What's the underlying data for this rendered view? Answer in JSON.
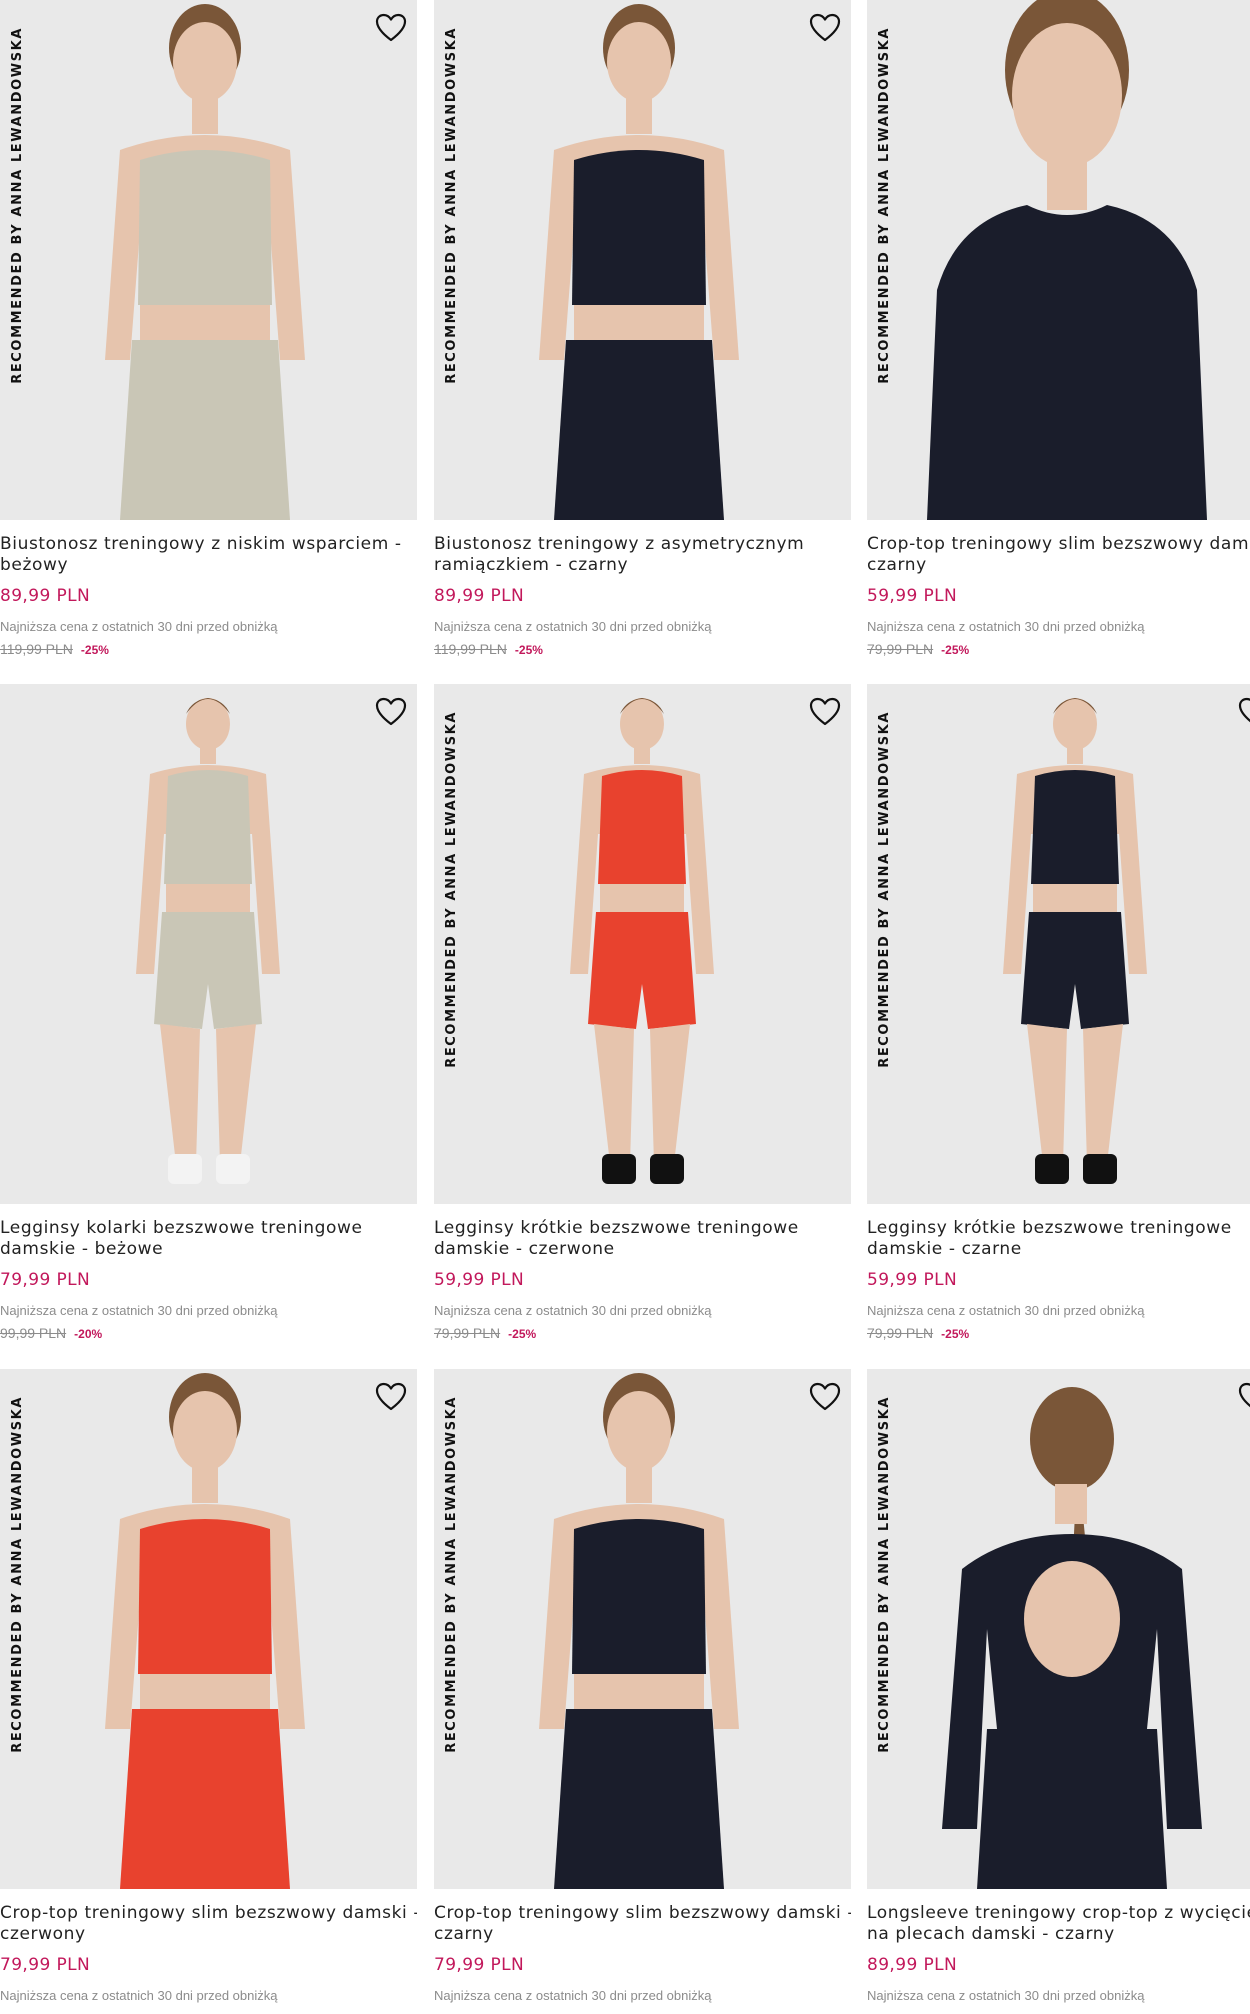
{
  "colors": {
    "price": "#c2185b",
    "muted": "#8c8c8c",
    "photo_bg": "#e9e9e9"
  },
  "rec_label": "RECOMMENDED BY ANNA LEWANDOWSKA",
  "lowest_label": "Najniższa cena z ostatnich 30 dni przed obniżką",
  "products": [
    {
      "title_l1": "Biustonosz treningowy z niskim wsparciem -",
      "title_l2": "beżowy",
      "price": "89,99 PLN",
      "old_price": "119,99 PLN",
      "discount": "-25%",
      "has_label": true,
      "top_color": "#c9c6b6",
      "bottom_color": "#c9c6b6",
      "icon": "heart-icon"
    },
    {
      "title_l1": "Biustonosz treningowy z asymetrycznym",
      "title_l2": "ramiączkiem - czarny",
      "price": "89,99 PLN",
      "old_price": "119,99 PLN",
      "discount": "-25%",
      "has_label": true,
      "top_color": "#1a1d2b",
      "bottom_color": "#1a1d2b",
      "icon": "heart-icon"
    },
    {
      "title_l1": "Crop-top treningowy slim bezszwowy damski -",
      "title_l2": "czarny",
      "price": "59,99 PLN",
      "old_price": "79,99 PLN",
      "discount": "-25%",
      "has_label": true,
      "top_color": "#1a1d2b",
      "bottom_color": "#1a1d2b",
      "icon": "heart-icon"
    },
    {
      "title_l1": "Legginsy kolarki bezszwowe treningowe",
      "title_l2": "damskie - beżowe",
      "price": "79,99 PLN",
      "old_price": "99,99 PLN",
      "discount": "-20%",
      "has_label": false,
      "top_color": "#c9c6b6",
      "bottom_color": "#c9c6b6",
      "icon": "heart-icon"
    },
    {
      "title_l1": "Legginsy krótkie bezszwowe treningowe",
      "title_l2": "damskie - czerwone",
      "price": "59,99 PLN",
      "old_price": "79,99 PLN",
      "discount": "-25%",
      "has_label": true,
      "top_color": "#e8422e",
      "bottom_color": "#e8422e",
      "icon": "heart-icon"
    },
    {
      "title_l1": "Legginsy krótkie bezszwowe treningowe",
      "title_l2": "damskie - czarne",
      "price": "59,99 PLN",
      "old_price": "79,99 PLN",
      "discount": "-25%",
      "has_label": true,
      "top_color": "#1a1d2b",
      "bottom_color": "#1a1d2b",
      "icon": "heart-icon"
    },
    {
      "title_l1": "Crop-top treningowy slim bezszwowy damski -",
      "title_l2": "czerwony",
      "price": "79,99 PLN",
      "has_label": true,
      "top_color": "#e8422e",
      "bottom_color": "#e8422e",
      "icon": "heart-icon"
    },
    {
      "title_l1": "Crop-top treningowy slim bezszwowy damski -",
      "title_l2": "czarny",
      "price": "79,99 PLN",
      "has_label": true,
      "top_color": "#1a1d2b",
      "bottom_color": "#1a1d2b",
      "icon": "heart-icon"
    },
    {
      "title_l1": "Longsleeve treningowy crop-top z wycięciem",
      "title_l2": "na plecach damski - czarny",
      "price": "89,99 PLN",
      "has_label": true,
      "top_color": "#1a1d2b",
      "bottom_color": "#1a1d2b",
      "icon": "heart-icon"
    }
  ]
}
